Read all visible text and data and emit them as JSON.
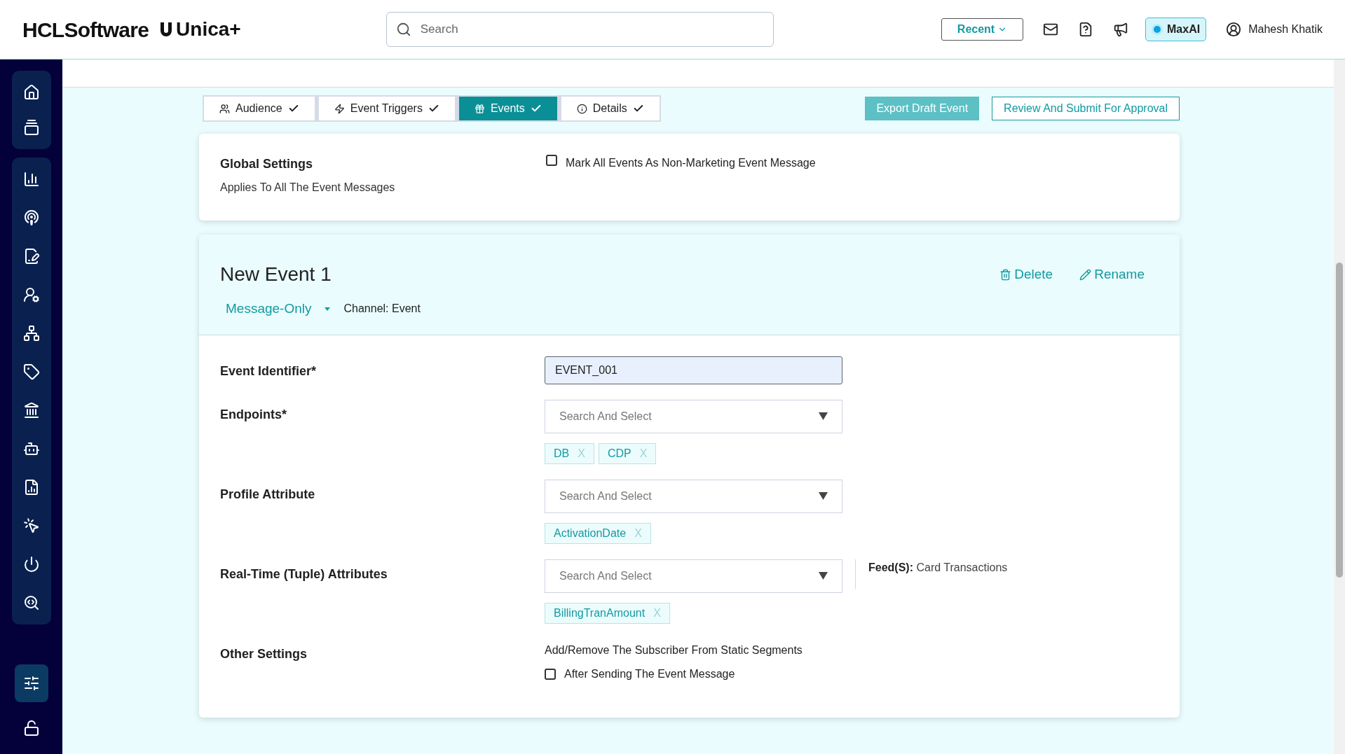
{
  "header": {
    "brand": "HCLSoftware",
    "product": "Unica+",
    "search": {
      "placeholder": "Search"
    },
    "recent": "Recent",
    "maxai": {
      "label": "MaxAI",
      "on": true
    },
    "user": "Mahesh Khatik"
  },
  "tabs": [
    {
      "label": "Audience",
      "selected": false,
      "done": true
    },
    {
      "label": "Event Triggers",
      "selected": false,
      "done": true
    },
    {
      "label": "Events",
      "selected": true,
      "done": true
    },
    {
      "label": "Details",
      "selected": false,
      "done": true
    }
  ],
  "actions": [
    {
      "label": "Export Draft Event",
      "kind": "primary"
    },
    {
      "label": "Review And Submit For Approval",
      "kind": "outline"
    }
  ],
  "global_settings": {
    "title": "Global Settings",
    "subtitle": "Applies To All The Event Messages",
    "checkbox": {
      "label": "Mark All Events As Non-Marketing Event Message",
      "checked": false
    }
  },
  "event": {
    "title": "New Event 1",
    "delete": "Delete",
    "rename": "Rename",
    "type": "Message-Only",
    "channel": "Channel: Event",
    "fields": [
      {
        "kind": "text",
        "label": "Event Identifier*",
        "value": "EVENT_001"
      },
      {
        "kind": "select",
        "label": "Endpoints*",
        "placeholder": "Search And Select",
        "tags": [
          {
            "label": "DB",
            "remove": "X"
          },
          {
            "label": "CDP",
            "remove": "X"
          }
        ]
      },
      {
        "kind": "select",
        "label": "Profile Attribute",
        "placeholder": "Search And Select",
        "tags": [
          {
            "label": "ActivationDate",
            "remove": "X"
          }
        ]
      },
      {
        "kind": "select",
        "label": "Real-Time (Tuple) Attributes",
        "placeholder": "Search And Select",
        "tags": [
          {
            "label": "BillingTranAmount",
            "remove": "X"
          }
        ],
        "note": {
          "label": "Feed(S):",
          "value": "Card Transactions"
        }
      },
      {
        "kind": "checkbox",
        "label": "Other Settings",
        "caption": "Add/Remove The Subscriber From Static Segments",
        "option": "After Sending The Event Message",
        "checked": false
      }
    ]
  }
}
